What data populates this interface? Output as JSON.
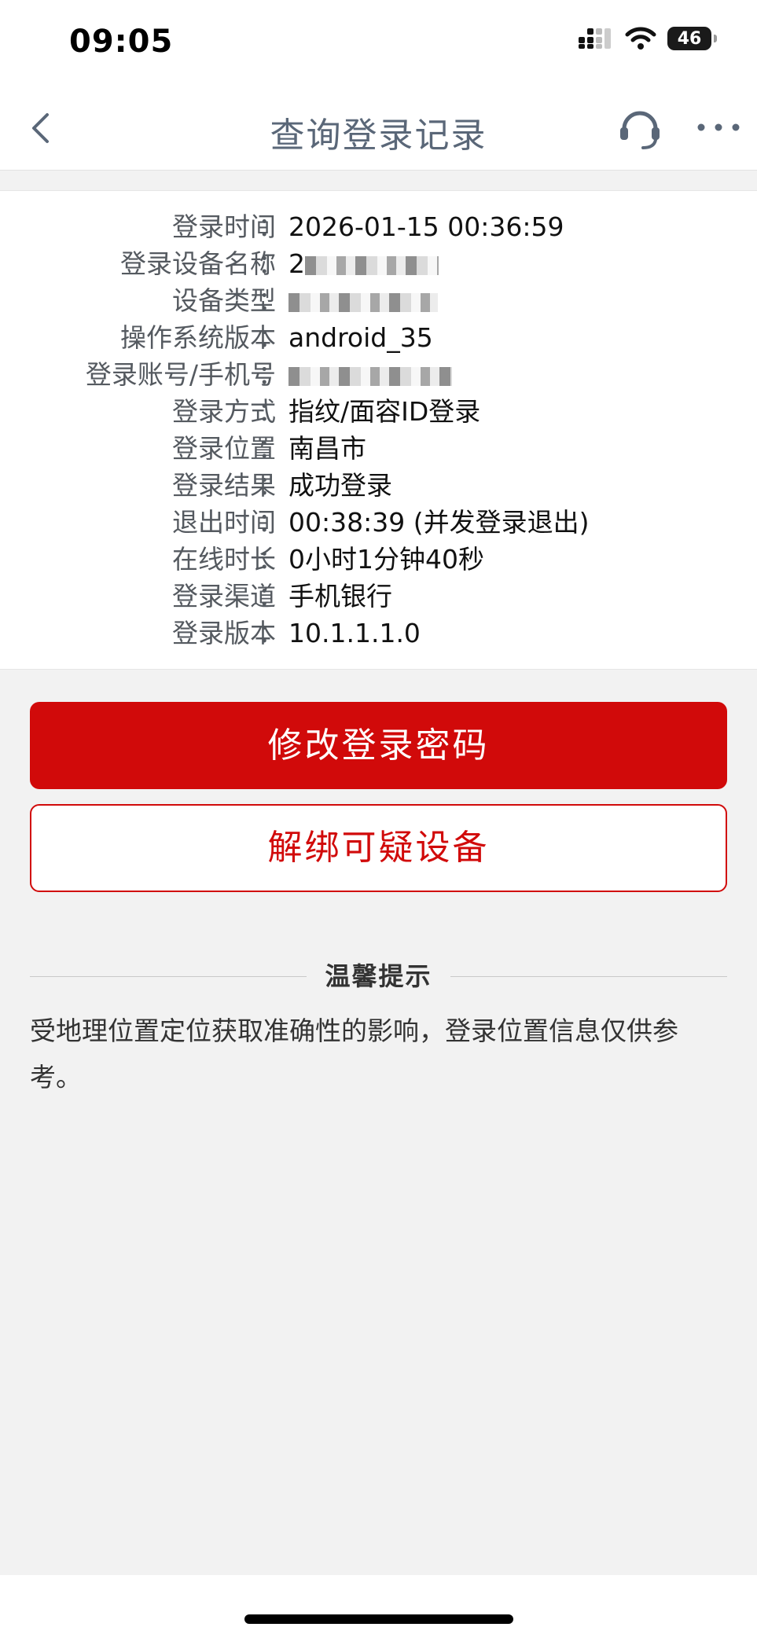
{
  "status_bar": {
    "time": "09:05",
    "battery": "46"
  },
  "nav": {
    "title": "查询登录记录",
    "back_icon": "chevron-left-icon",
    "service_icon": "headset-icon",
    "more_icon": "more-horizontal-icon"
  },
  "record": {
    "colon": "：",
    "rows": [
      {
        "label": "登录时间",
        "value": "2026-01-15   00:36:59"
      },
      {
        "label": "登录设备名称",
        "value": "2"
      },
      {
        "label": "设备类型",
        "value": ""
      },
      {
        "label": "操作系统版本",
        "value": "android_35"
      },
      {
        "label": "登录账号/手机号",
        "value": ""
      },
      {
        "label": "登录方式",
        "value": "指纹/面容ID登录"
      },
      {
        "label": "登录位置",
        "value": "南昌市"
      },
      {
        "label": "登录结果",
        "value": "成功登录"
      },
      {
        "label": "退出时间",
        "value": "00:38:39 (并发登录退出)"
      },
      {
        "label": "在线时长",
        "value": "0小时1分钟40秒"
      },
      {
        "label": "登录渠道",
        "value": "手机银行"
      },
      {
        "label": "登录版本",
        "value": "10.1.1.1.0"
      }
    ]
  },
  "actions": {
    "change_password": "修改登录密码",
    "unbind_device": "解绑可疑设备"
  },
  "tips": {
    "title": "温馨提示",
    "text": "受地理位置定位获取准确性的影响，登录位置信息仅供参考。"
  },
  "colors": {
    "accent": "#d10a0a",
    "background": "#f2f2f2",
    "nav_title": "#5a6778"
  }
}
